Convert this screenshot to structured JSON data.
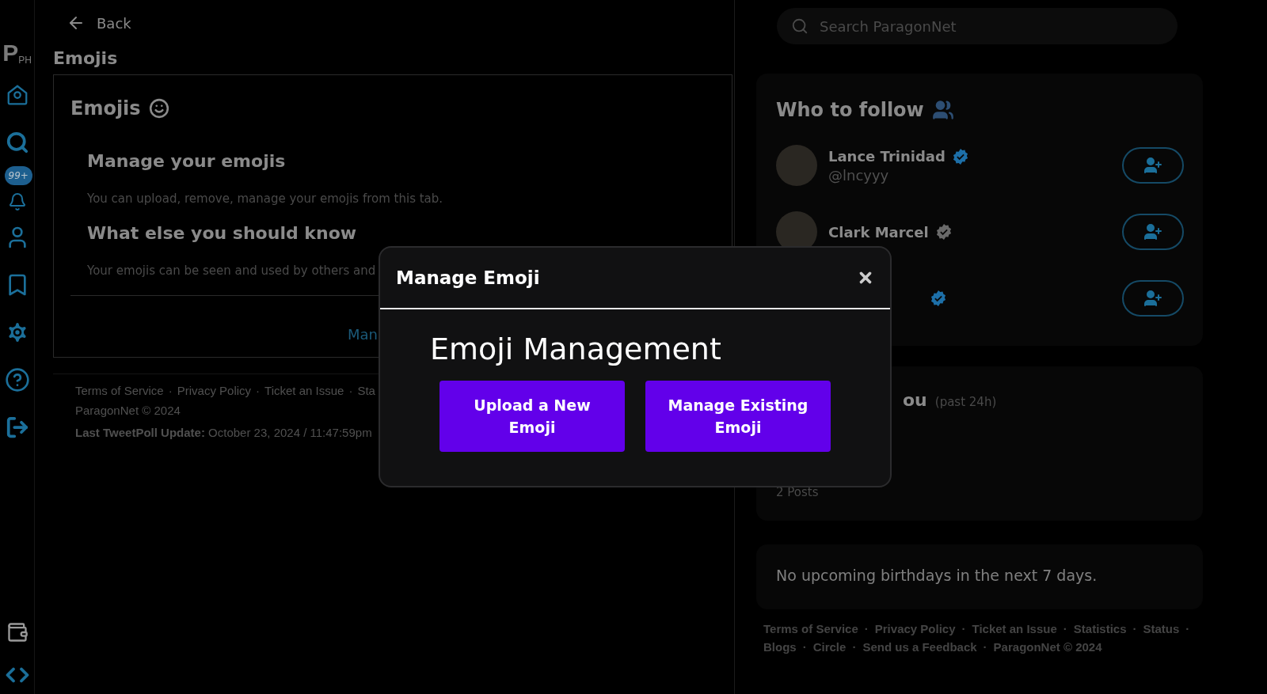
{
  "sidebar": {
    "logo": {
      "letter": "P",
      "suffix": "PH"
    },
    "notification_badge": "99+"
  },
  "header": {
    "back_label": "Back",
    "title": "Emojis"
  },
  "emoji_card": {
    "title": "Emojis",
    "sections": [
      {
        "heading": "Manage your emojis",
        "text": "You can upload, remove, manage your emojis from this tab."
      },
      {
        "heading": "What else you should know",
        "text": "Your emojis can be seen and used by others and"
      }
    ],
    "link": "Man"
  },
  "main_footer": {
    "separator": "·",
    "links": [
      "Terms of Service",
      "Privacy Policy",
      "Ticket an Issue",
      "Sta"
    ],
    "copyright": "ParagonNet © 2024",
    "update_label": "Last TweetPoll Update:",
    "update_value": "October 23, 2024 / 11:47:59pm"
  },
  "search": {
    "placeholder": "Search ParagonNet"
  },
  "who_to_follow": {
    "title": "Who to follow",
    "users": [
      {
        "name": "Lance Trinidad",
        "handle": "@lncyyy",
        "color": "#1d6fa8"
      },
      {
        "name": "Clark Marcel",
        "color": "#6a6a6a"
      },
      {
        "color": "#1d6fa8"
      }
    ]
  },
  "trending": {
    "title": "ou",
    "note": "(past 24h)",
    "count": "2 Posts"
  },
  "birthdays": {
    "text": "No upcoming birthdays in the next 7 days."
  },
  "side_footer": {
    "separator": "·",
    "links": [
      "Terms of Service",
      "Privacy Policy",
      "Ticket an Issue",
      "Statistics",
      "Status",
      "Blogs",
      "Circle",
      "Send us a Feedback",
      "ParagonNet © 2024"
    ]
  },
  "modal": {
    "title": "Manage Emoji",
    "heading": "Emoji Management",
    "buttons": [
      "Upload a New Emoji",
      "Manage Existing Emoji"
    ]
  }
}
